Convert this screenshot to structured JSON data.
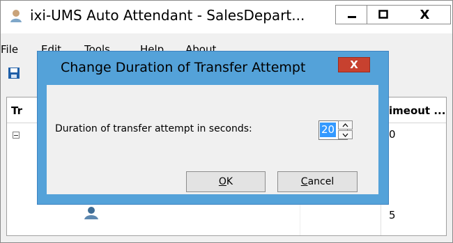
{
  "window": {
    "title": "ixi-UMS Auto Attendant - SalesDepart...",
    "minimize_glyph": "−",
    "maximize_glyph": "□",
    "close_glyph": "X"
  },
  "menu": [
    "File",
    "Edit",
    "Tools",
    "Help",
    "About"
  ],
  "toolbar": {
    "save_icon": "save-icon"
  },
  "tree": {
    "columns": [
      "Tr",
      "imeout ..."
    ],
    "rows": [
      {
        "timeout": "0"
      },
      {
        "timeout": "5"
      }
    ]
  },
  "dialog": {
    "title": "Change Duration of Transfer Attempt",
    "close_glyph": "X",
    "label": "Duration of transfer attempt in seconds:",
    "value": "20",
    "ok": {
      "mnemonic": "O",
      "rest": "K"
    },
    "cancel": {
      "mnemonic": "C",
      "rest": "ancel"
    }
  },
  "colors": {
    "dialog_frame": "#54a2d9",
    "close_red": "#c7412f",
    "selection": "#3399ff"
  }
}
